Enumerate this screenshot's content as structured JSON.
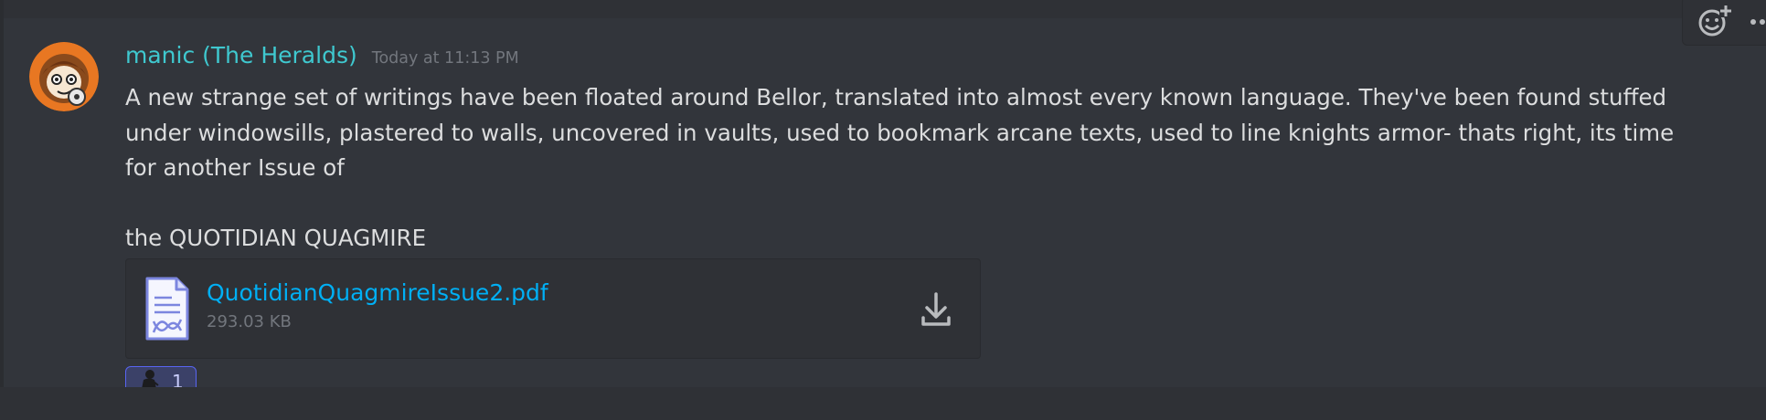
{
  "message": {
    "username": "manic (The Heralds)",
    "timestamp": "Today at 11:13 PM",
    "content": "A new strange set of writings have been floated around Bellor, translated into almost every known language. They've been found stuffed under windowsills, plastered to walls, uncovered in vaults, used to bookmark arcane texts, used to line knights armor- thats right, its time for another Issue of\n\nthe QUOTIDIAN QUAGMIRE"
  },
  "attachment": {
    "file_name": "QuotidianQuagmireIssue2.pdf",
    "file_size": "293.03 KB",
    "icon": "document-icon",
    "action_icon": "download-icon"
  },
  "reaction": {
    "emoji_icon": "dark-figure-emoji",
    "count": "1"
  },
  "toolbar": {
    "icons": [
      "add-reaction-icon",
      "more-options-icon"
    ]
  },
  "colors": {
    "background": "#32353b",
    "username": "#3fc8cf",
    "link": "#00aff4",
    "text": "#dcddde",
    "muted": "#72767d",
    "reaction_bg": "#3b4168",
    "reaction_border": "#5865f2"
  }
}
